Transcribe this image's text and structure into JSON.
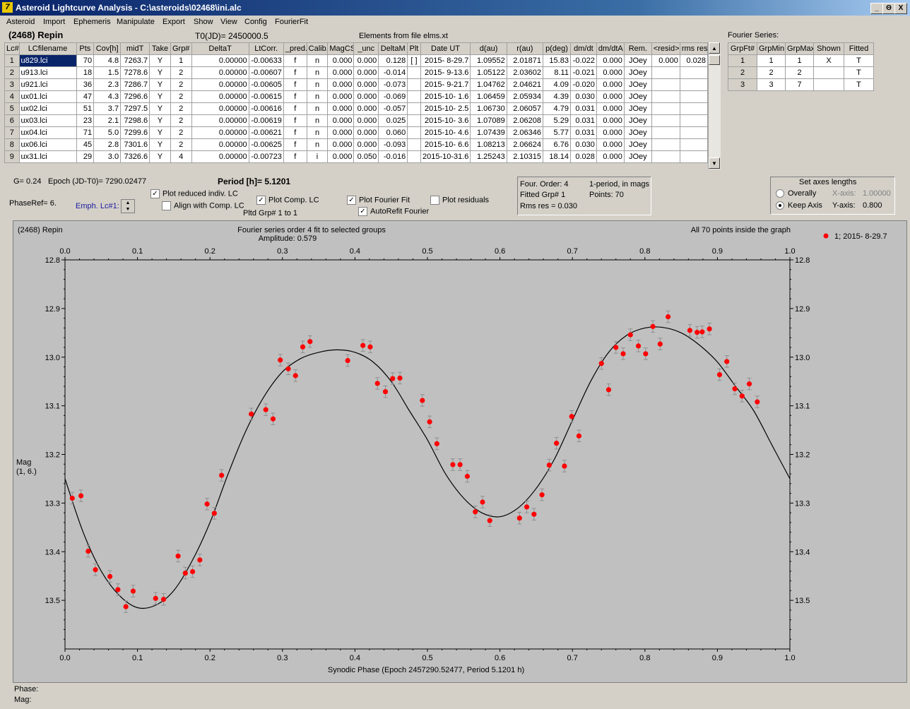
{
  "window": {
    "title": "Asteroid Lightcurve Analysis - C:\\asteroids\\02468\\ini.alc",
    "icon_name": "app-icon",
    "controls": [
      "_",
      "Θ",
      "X"
    ]
  },
  "menu": [
    "Asteroid",
    "Import",
    "Ephemeris",
    "Manipulate",
    "Export",
    "Show",
    "View",
    "Config",
    "FourierFit"
  ],
  "header": {
    "asteroid": "(2468) Repin",
    "t0": "T0(JD)= 2450000.5",
    "elements": "Elements from file elms.xt"
  },
  "lc_table": {
    "columns": [
      "Lc#",
      "LCfilename",
      "Pts",
      "Cov[h]",
      "midT",
      "Take",
      "Grp#",
      "DeltaT",
      "LtCorr.",
      "_pred.",
      "Calib.",
      "MagCS",
      "_unc",
      "DeltaM",
      "Plt",
      "Date UT",
      "d(au)",
      "r(au)",
      "p(deg)",
      "dm/dt",
      "dm/dtA",
      "Rem.",
      "<resid>",
      "rms res"
    ],
    "rows": [
      [
        "1",
        "u829.lci",
        "70",
        "4.8",
        "7263.7",
        "Y",
        "1",
        "0.00000",
        "-0.00633",
        "f",
        "n",
        "0.000",
        "0.000",
        "0.128",
        "[ ]",
        "2015- 8-29.7",
        "1.09552",
        "2.01871",
        "15.83",
        "-0.022",
        "0.000",
        "JOey",
        "0.000",
        "0.028"
      ],
      [
        "2",
        "u913.lci",
        "18",
        "1.5",
        "7278.6",
        "Y",
        "2",
        "0.00000",
        "-0.00607",
        "f",
        "n",
        "0.000",
        "0.000",
        "-0.014",
        "",
        "2015- 9-13.6",
        "1.05122",
        "2.03602",
        "8.11",
        "-0.021",
        "0.000",
        "JOey",
        "",
        ""
      ],
      [
        "3",
        "u921.lci",
        "36",
        "2.3",
        "7286.7",
        "Y",
        "2",
        "0.00000",
        "-0.00605",
        "f",
        "n",
        "0.000",
        "0.000",
        "-0.073",
        "",
        "2015- 9-21.7",
        "1.04762",
        "2.04621",
        "4.09",
        "-0.020",
        "0.000",
        "JOey",
        "",
        ""
      ],
      [
        "4",
        "ux01.lci",
        "47",
        "4.3",
        "7296.6",
        "Y",
        "2",
        "0.00000",
        "-0.00615",
        "f",
        "n",
        "0.000",
        "0.000",
        "-0.069",
        "",
        "2015-10- 1.6",
        "1.06459",
        "2.05934",
        "4.39",
        "0.030",
        "0.000",
        "JOey",
        "",
        ""
      ],
      [
        "5",
        "ux02.lci",
        "51",
        "3.7",
        "7297.5",
        "Y",
        "2",
        "0.00000",
        "-0.00616",
        "f",
        "n",
        "0.000",
        "0.000",
        "-0.057",
        "",
        "2015-10- 2.5",
        "1.06730",
        "2.06057",
        "4.79",
        "0.031",
        "0.000",
        "JOey",
        "",
        ""
      ],
      [
        "6",
        "ux03.lci",
        "23",
        "2.1",
        "7298.6",
        "Y",
        "2",
        "0.00000",
        "-0.00619",
        "f",
        "n",
        "0.000",
        "0.000",
        "0.025",
        "",
        "2015-10- 3.6",
        "1.07089",
        "2.06208",
        "5.29",
        "0.031",
        "0.000",
        "JOey",
        "",
        ""
      ],
      [
        "7",
        "ux04.lci",
        "71",
        "5.0",
        "7299.6",
        "Y",
        "2",
        "0.00000",
        "-0.00621",
        "f",
        "n",
        "0.000",
        "0.000",
        "0.060",
        "",
        "2015-10- 4.6",
        "1.07439",
        "2.06346",
        "5.77",
        "0.031",
        "0.000",
        "JOey",
        "",
        ""
      ],
      [
        "8",
        "ux06.lci",
        "45",
        "2.8",
        "7301.6",
        "Y",
        "2",
        "0.00000",
        "-0.00625",
        "f",
        "n",
        "0.000",
        "0.000",
        "-0.093",
        "",
        "2015-10- 6.6",
        "1.08213",
        "2.06624",
        "6.76",
        "0.030",
        "0.000",
        "JOey",
        "",
        ""
      ],
      [
        "9",
        "ux31.lci",
        "29",
        "3.0",
        "7326.6",
        "Y",
        "4",
        "0.00000",
        "-0.00723",
        "f",
        "i",
        "0.000",
        "0.050",
        "-0.016",
        "",
        "2015-10-31.6",
        "1.25243",
        "2.10315",
        "18.14",
        "0.028",
        "0.000",
        "JOey",
        "",
        ""
      ]
    ]
  },
  "fourier_table": {
    "caption": "Fourier Series:",
    "columns": [
      "GrpFt#",
      "GrpMin",
      "GrpMax",
      "Shown",
      "Fitted"
    ],
    "rows": [
      [
        "1",
        "1",
        "1",
        "X",
        "T"
      ],
      [
        "2",
        "2",
        "2",
        "",
        "T"
      ],
      [
        "3",
        "3",
        "7",
        "",
        "T"
      ]
    ]
  },
  "controls": {
    "g_value": "G= 0.24",
    "epoch": "Epoch (JD-T0)= 7290.02477",
    "period": "Period [h]= 5.1201",
    "phase_ref": "PhaseRef= 6.",
    "emph_lc": "Emph. Lc#1:",
    "plot_reduced": "Plot reduced indiv. LC",
    "align_comp": "Align with Comp. LC",
    "plot_comp": "Plot Comp. LC",
    "pltd_grp": "Pltd Grp#  1   to   1",
    "plot_fourier": "Plot Fourier Fit",
    "autorefit": "AutoRefit Fourier",
    "plot_residuals": "Plot residuals",
    "checked": {
      "plot_reduced": true,
      "align_comp": false,
      "plot_comp": true,
      "plot_fourier": true,
      "autorefit": true,
      "plot_residuals": false
    }
  },
  "fourier_info": {
    "order": "Four. Order:  4",
    "mode": "1-period, in mags",
    "fitted": "Fitted Grp# 1",
    "points": "Points: 70",
    "rms": "Rms res     = 0.030"
  },
  "axes_box": {
    "title": "Set axes lengths",
    "overally": "Overally",
    "keep_axis": "Keep Axis",
    "x_label": "X-axis:",
    "x_value": "1.00000",
    "y_label": "Y-axis:",
    "y_value": "0.800",
    "selected": "keep_axis"
  },
  "plot": {
    "name": "(2468) Repin",
    "subtitle": "Fourier series order 4 fit to selected groups",
    "amplitude": "Amplitude: 0.579",
    "points_info": "All 70 points inside the graph",
    "legend": "1; 2015- 8-29.7",
    "ylabel_1": "Mag",
    "ylabel_2": "(1, 6.)",
    "xlabel": "Synodic Phase (Epoch 2457290.52477, Period 5.1201 h)",
    "point_color": "#ff0000",
    "bg_color": "#c0c0c0"
  },
  "status": {
    "phase": "Phase:",
    "mag": "Mag:"
  },
  "chart_data": {
    "type": "scatter",
    "title": "Fourier series order 4 fit to selected groups",
    "xlabel": "Synodic Phase (Epoch 2457290.52477, Period 5.1201 h)",
    "ylabel": "Mag",
    "xlim": [
      0.0,
      1.0
    ],
    "ylim": [
      12.8,
      13.6
    ],
    "y_inverted": true,
    "xticks": [
      "0.0",
      "0.1",
      "0.2",
      "0.3",
      "0.4",
      "0.5",
      "0.6",
      "0.7",
      "0.8",
      "0.9",
      "1.0"
    ],
    "yticks": [
      "12.8",
      "12.9",
      "13.0",
      "13.1",
      "13.2",
      "13.3",
      "13.4",
      "13.5"
    ],
    "grid": false,
    "legend_position": "right",
    "series": [
      {
        "name": "1; 2015- 8-29.7",
        "error": 0.012,
        "x": [
          0.01,
          0.022,
          0.032,
          0.042,
          0.062,
          0.073,
          0.084,
          0.094,
          0.125,
          0.136,
          0.156,
          0.166,
          0.176,
          0.186,
          0.196,
          0.206,
          0.216,
          0.257,
          0.277,
          0.287,
          0.297,
          0.308,
          0.318,
          0.328,
          0.338,
          0.39,
          0.411,
          0.421,
          0.431,
          0.442,
          0.452,
          0.462,
          0.493,
          0.503,
          0.513,
          0.535,
          0.545,
          0.555,
          0.566,
          0.576,
          0.586,
          0.627,
          0.637,
          0.647,
          0.658,
          0.668,
          0.678,
          0.689,
          0.699,
          0.709,
          0.74,
          0.75,
          0.76,
          0.77,
          0.78,
          0.791,
          0.801,
          0.811,
          0.821,
          0.832,
          0.862,
          0.872,
          0.879,
          0.889,
          0.903,
          0.913,
          0.924,
          0.934,
          0.944,
          0.955
        ],
        "y": [
          13.29,
          13.285,
          13.399,
          13.437,
          13.451,
          13.478,
          13.513,
          13.481,
          13.496,
          13.498,
          13.409,
          13.444,
          13.441,
          13.417,
          13.302,
          13.321,
          13.243,
          13.117,
          13.108,
          13.127,
          13.006,
          13.024,
          13.038,
          12.979,
          12.968,
          13.007,
          12.976,
          12.979,
          13.054,
          13.071,
          13.044,
          13.043,
          13.089,
          13.133,
          13.178,
          13.221,
          13.221,
          13.245,
          13.318,
          13.298,
          13.336,
          13.331,
          13.308,
          13.323,
          13.283,
          13.222,
          13.177,
          13.224,
          13.122,
          13.162,
          13.013,
          13.067,
          12.98,
          12.993,
          12.954,
          12.977,
          12.993,
          12.937,
          12.973,
          12.917,
          12.945,
          12.949,
          12.948,
          12.942,
          13.036,
          13.009,
          13.065,
          13.08,
          13.055,
          13.092
        ]
      }
    ],
    "fit": {
      "name": "Fourier fit",
      "x": [
        0.0,
        0.025,
        0.05,
        0.075,
        0.1,
        0.125,
        0.15,
        0.175,
        0.2,
        0.225,
        0.25,
        0.275,
        0.3,
        0.325,
        0.35,
        0.375,
        0.4,
        0.425,
        0.45,
        0.475,
        0.5,
        0.525,
        0.55,
        0.575,
        0.6,
        0.625,
        0.65,
        0.675,
        0.7,
        0.725,
        0.75,
        0.775,
        0.8,
        0.825,
        0.85,
        0.875,
        0.9,
        0.925,
        0.95,
        0.975,
        1.0
      ],
      "y": [
        13.25,
        13.36,
        13.44,
        13.49,
        13.515,
        13.51,
        13.48,
        13.42,
        13.34,
        13.24,
        13.15,
        13.08,
        13.03,
        13.003,
        12.99,
        12.985,
        12.99,
        13.01,
        13.05,
        13.11,
        13.17,
        13.24,
        13.29,
        13.32,
        13.328,
        13.31,
        13.27,
        13.21,
        13.13,
        13.05,
        12.99,
        12.955,
        12.94,
        12.939,
        12.95,
        12.975,
        13.01,
        13.06,
        13.11,
        13.18,
        13.25
      ]
    }
  }
}
